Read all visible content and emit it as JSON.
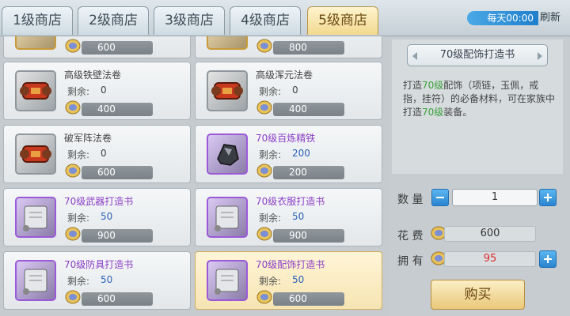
{
  "tabs": [
    {
      "label": "1级商店",
      "active": false
    },
    {
      "label": "2级商店",
      "active": false
    },
    {
      "label": "3级商店",
      "active": false
    },
    {
      "label": "4级商店",
      "active": false
    },
    {
      "label": "5级商店",
      "active": true
    }
  ],
  "refresh": {
    "time": "每天00:00",
    "button": "刷新"
  },
  "remain_label": "剩余:",
  "items": [
    {
      "name": "",
      "remain": "",
      "price": "600",
      "icon": "green-scroll-icon"
    },
    {
      "name": "",
      "remain": "",
      "price": "800",
      "icon": "green-scroll-icon"
    },
    {
      "name": "高级铁壁法卷",
      "remain": "0",
      "price": "400",
      "icon": "red-scroll-icon"
    },
    {
      "name": "高级浑元法卷",
      "remain": "0",
      "price": "400",
      "icon": "red-scroll-icon"
    },
    {
      "name": "破军阵法卷",
      "remain": "0",
      "price": "600",
      "icon": "red-scroll-icon"
    },
    {
      "name": "70级百炼精铁",
      "remain": "200",
      "price": "200",
      "icon": "iron-ore-icon"
    },
    {
      "name": "70级武器打造书",
      "remain": "50",
      "price": "900",
      "icon": "blueprint-scroll-icon"
    },
    {
      "name": "70级衣服打造书",
      "remain": "50",
      "price": "900",
      "icon": "blueprint-scroll-icon"
    },
    {
      "name": "70级防具打造书",
      "remain": "50",
      "price": "600",
      "icon": "blueprint-scroll-icon"
    },
    {
      "name": "70级配饰打造书",
      "remain": "50",
      "price": "600",
      "icon": "blueprint-scroll-icon",
      "selected": true
    }
  ],
  "detail": {
    "title": "70级配饰打造书",
    "desc_1": "打造",
    "desc_hl1": "70级",
    "desc_2": "配饰（项链，玉佩，戒指，挂符）的必备材料，可在家族中打造",
    "desc_hl2": "70级",
    "desc_3": "装备。"
  },
  "purchase": {
    "qty_label": "数 量",
    "qty": "1",
    "cost_label": "花 费",
    "cost": "600",
    "own_label": "拥 有",
    "own": "95",
    "buy_label": "购买"
  },
  "colors": {
    "accent_gold": "#f2d98f",
    "button_blue": "#2a84cf",
    "highlight_green": "#3aa03a",
    "warning_red": "#e02a2a"
  }
}
